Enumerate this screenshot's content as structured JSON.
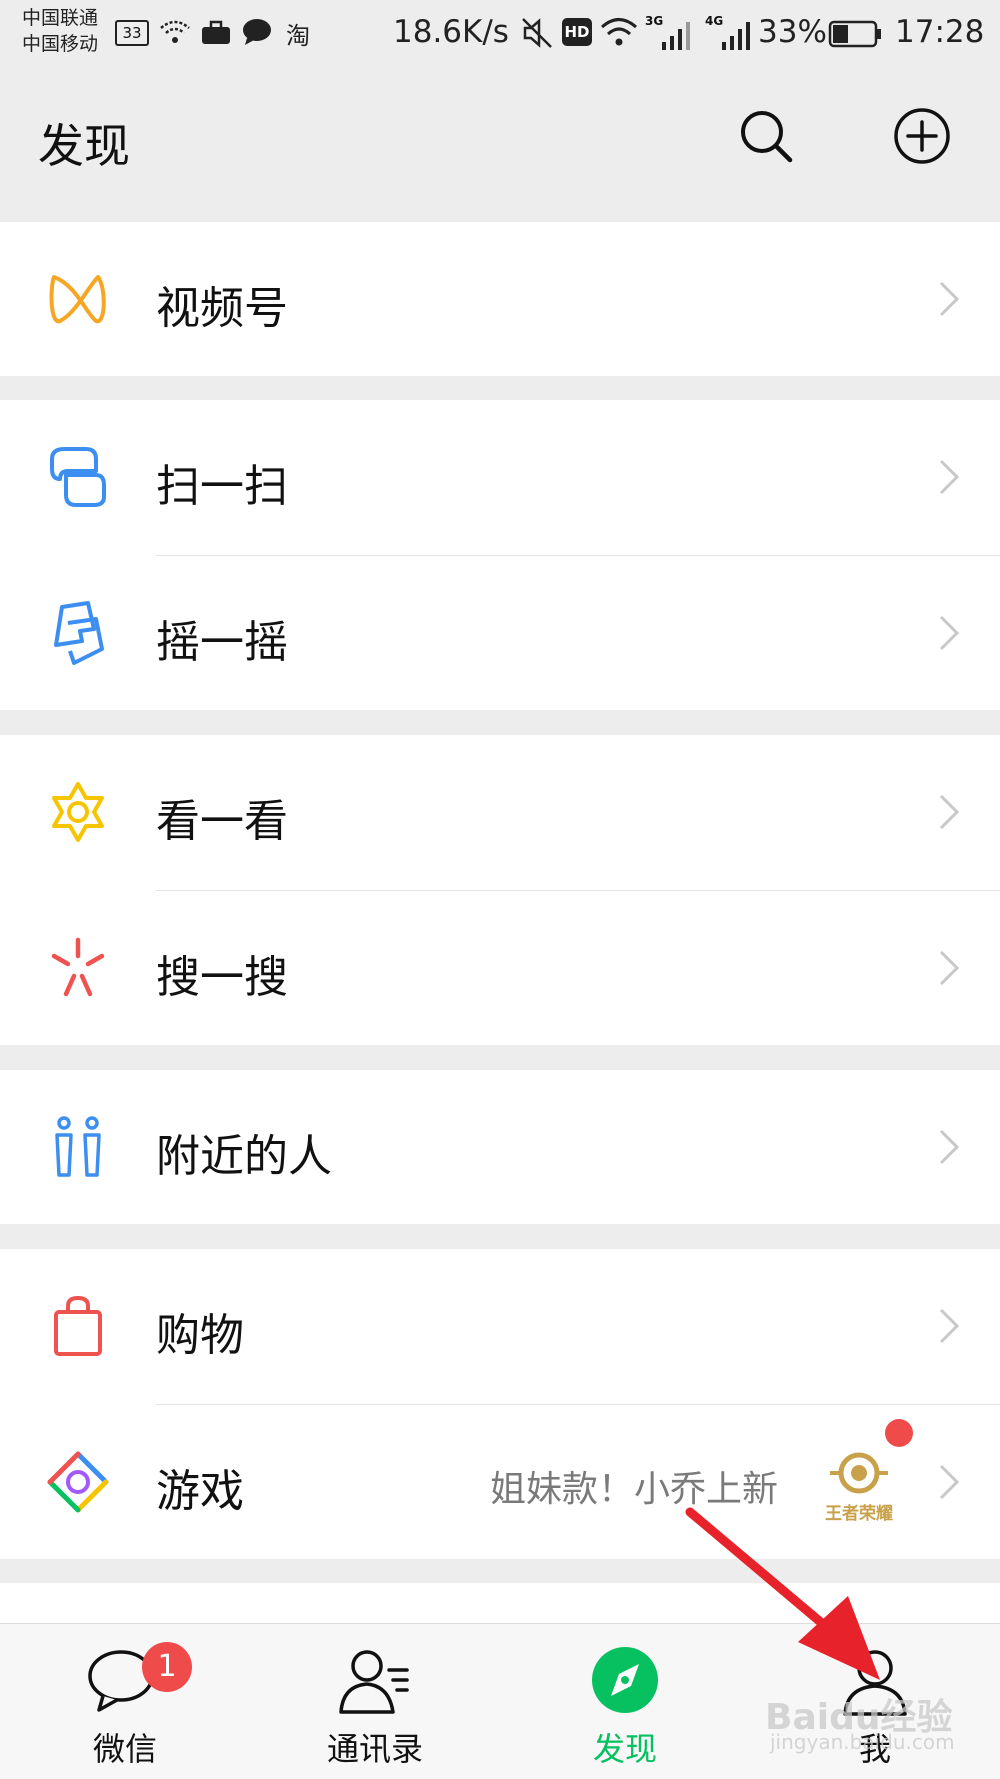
{
  "status_bar": {
    "carrier_1": "中国联通",
    "carrier_2": "中国移动",
    "box_33": "33",
    "taobao": "淘",
    "net_speed": "18.6K/s",
    "hd": "HD",
    "sig_3g": "3G",
    "sig_4g": "4G",
    "battery": "33%",
    "time": "17:28"
  },
  "header": {
    "title": "发现"
  },
  "menu": {
    "channels": "视频号",
    "scan": "扫一扫",
    "shake": "摇一摇",
    "top_stories": "看一看",
    "search": "搜一搜",
    "nearby": "附近的人",
    "shopping": "购物",
    "games": "游戏",
    "games_subtitle": "姐妹款！小乔上新",
    "games_logo_text": "王者荣耀"
  },
  "tabbar": {
    "chats": "微信",
    "chats_badge": "1",
    "contacts": "通讯录",
    "discover": "发现",
    "me": "我"
  },
  "watermark": {
    "main": "Baidu经验",
    "sub": "jingyan.baidu.com"
  },
  "colors": {
    "accent_green": "#07c160",
    "badge_red": "#f04b4b",
    "arrow_red": "#e8222a",
    "background": "#ededed"
  }
}
